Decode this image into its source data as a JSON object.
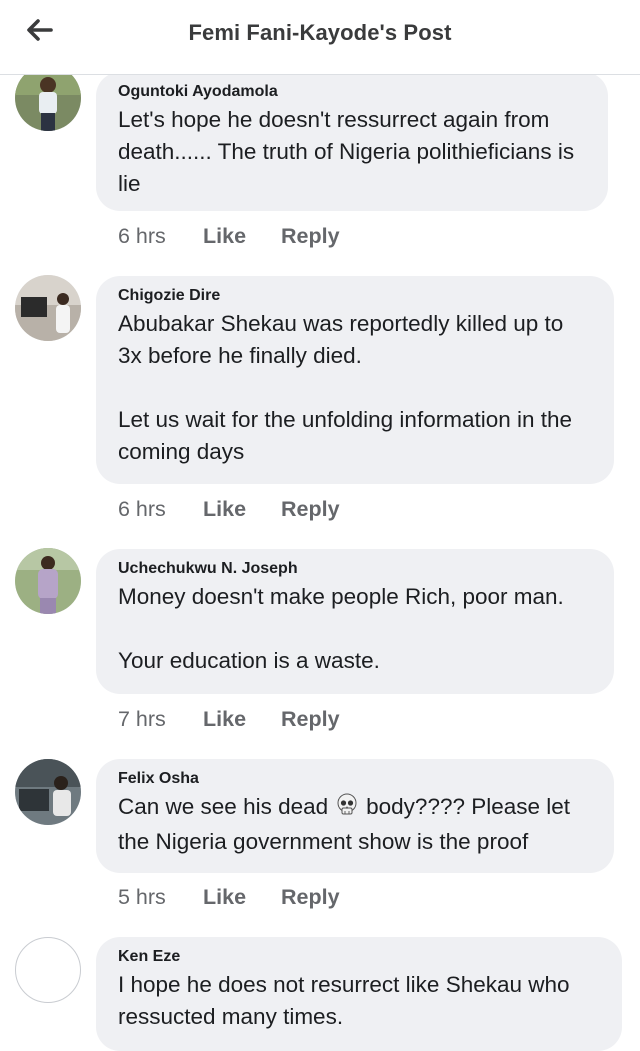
{
  "header": {
    "title": "Femi Fani-Kayode's Post",
    "back_icon": "arrow-left-icon"
  },
  "comments": [
    {
      "author": "Oguntoki Ayodamola",
      "text": "Let's hope he doesn't ressurrect again from death...... The truth of Nigeria polithieficians is lie",
      "time": "6 hrs",
      "like": "Like",
      "reply": "Reply"
    },
    {
      "author": "Chigozie Dire",
      "text": "Abubakar Shekau was reportedly killed up to 3x before he finally died.\n\nLet us wait for the unfolding information in the coming days",
      "time": "6 hrs",
      "like": "Like",
      "reply": "Reply"
    },
    {
      "author": "Uchechukwu N. Joseph",
      "text": "Money doesn't make people Rich, poor man.\n\nYour education is a waste.",
      "time": "7 hrs",
      "like": "Like",
      "reply": "Reply"
    },
    {
      "author": "Felix Osha",
      "text_before": "Can we see his dead",
      "emoji": "skull-emoji",
      "text_after": "body???? Please let the Nigeria government show is the proof",
      "time": "5 hrs",
      "like": "Like",
      "reply": "Reply"
    },
    {
      "author": "Ken Eze",
      "text": "I hope he does not resurrect like Shekau who ressucted many times."
    }
  ],
  "colors": {
    "bubble": "#eff0f3",
    "meta_text": "#65676b",
    "header_divider": "#dcdfe3"
  }
}
